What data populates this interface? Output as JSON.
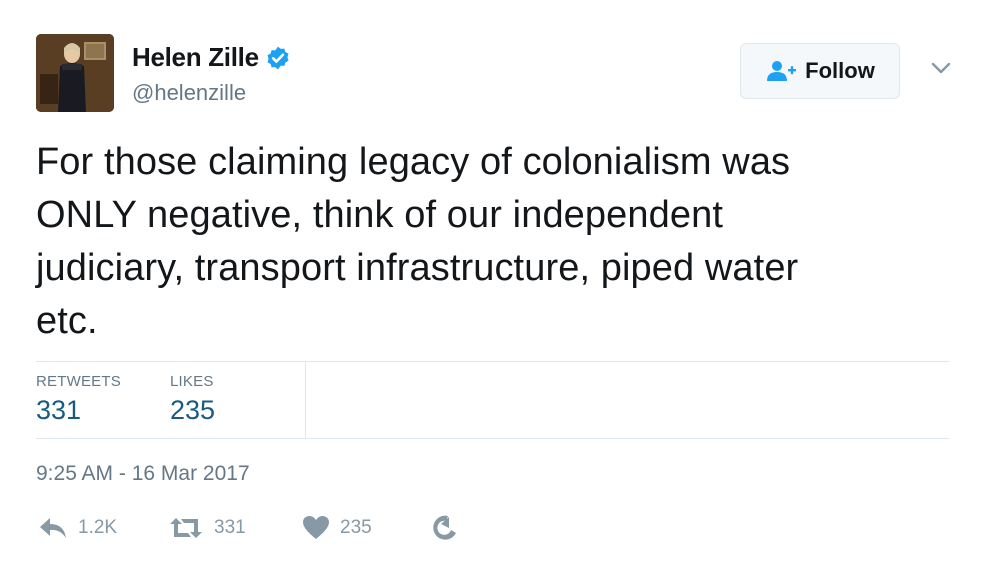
{
  "user": {
    "display_name": "Helen Zille",
    "handle": "@helenzille",
    "verified": true
  },
  "follow_button": {
    "label": "Follow"
  },
  "tweet": {
    "lines": [
      "For those claiming legacy of colonialism was",
      "ONLY negative, think of our independent",
      "judiciary, transport infrastructure, piped water",
      "etc."
    ]
  },
  "stats": {
    "retweets_label": "RETWEETS",
    "retweets_value": "331",
    "likes_label": "LIKES",
    "likes_value": "235"
  },
  "timestamp": "9:25 AM - 16 Mar 2017",
  "actions": {
    "reply_count": "1.2K",
    "retweet_count": "331",
    "like_count": "235"
  },
  "colors": {
    "verified": "#1da1f2",
    "text": "#14171a",
    "muted": "#657786",
    "stat_value": "#1b5a80",
    "action": "#8899a6",
    "divider": "#e1e8ed"
  },
  "icons": {
    "verified": "verified-badge-icon",
    "follow": "add-user-icon",
    "chevron": "chevron-down-icon",
    "reply": "reply-icon",
    "retweet": "retweet-icon",
    "like": "heart-icon",
    "moments": "moments-icon"
  }
}
